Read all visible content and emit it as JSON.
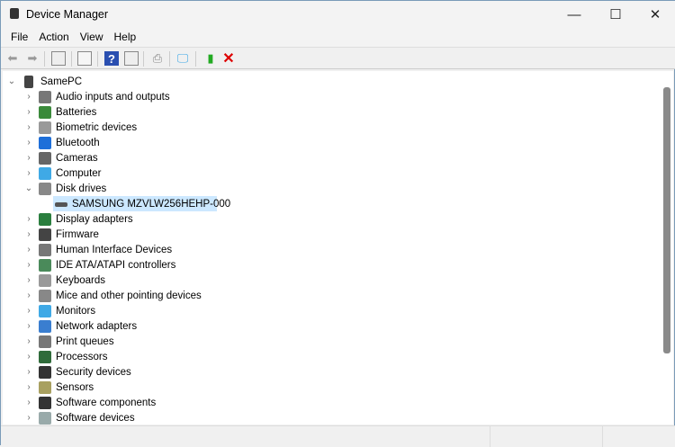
{
  "window": {
    "title": "Device Manager",
    "minimize": "—",
    "maximize": "☐",
    "close": "✕"
  },
  "menu": [
    "File",
    "Action",
    "View",
    "Help"
  ],
  "toolbar": [
    "back",
    "forward",
    "show-hide-console-tree",
    "properties",
    "help",
    "action-pane",
    "scan-hardware",
    "update-driver",
    "enable-device",
    "uninstall-device"
  ],
  "tree": {
    "root": "SamePC",
    "items": [
      {
        "label": "Audio inputs and outputs",
        "color": "#777"
      },
      {
        "label": "Batteries",
        "color": "#3a8a3a"
      },
      {
        "label": "Biometric devices",
        "color": "#999"
      },
      {
        "label": "Bluetooth",
        "color": "#1e6fd9"
      },
      {
        "label": "Cameras",
        "color": "#666"
      },
      {
        "label": "Computer",
        "color": "#3fa9e6"
      },
      {
        "label": "Disk drives",
        "color": "#888",
        "expanded": true,
        "children": [
          "SAMSUNG MZVLW256HEHP-000"
        ]
      },
      {
        "label": "Display adapters",
        "color": "#2a7e3e"
      },
      {
        "label": "Firmware",
        "color": "#444"
      },
      {
        "label": "Human Interface Devices",
        "color": "#777"
      },
      {
        "label": "IDE ATA/ATAPI controllers",
        "color": "#4a8a5a"
      },
      {
        "label": "Keyboards",
        "color": "#999"
      },
      {
        "label": "Mice and other pointing devices",
        "color": "#888"
      },
      {
        "label": "Monitors",
        "color": "#3fa9e6"
      },
      {
        "label": "Network adapters",
        "color": "#3a7ed0"
      },
      {
        "label": "Print queues",
        "color": "#777"
      },
      {
        "label": "Processors",
        "color": "#2f6b3a"
      },
      {
        "label": "Security devices",
        "color": "#333"
      },
      {
        "label": "Sensors",
        "color": "#a8a060"
      },
      {
        "label": "Software components",
        "color": "#333"
      },
      {
        "label": "Software devices",
        "color": "#9aa"
      }
    ]
  }
}
